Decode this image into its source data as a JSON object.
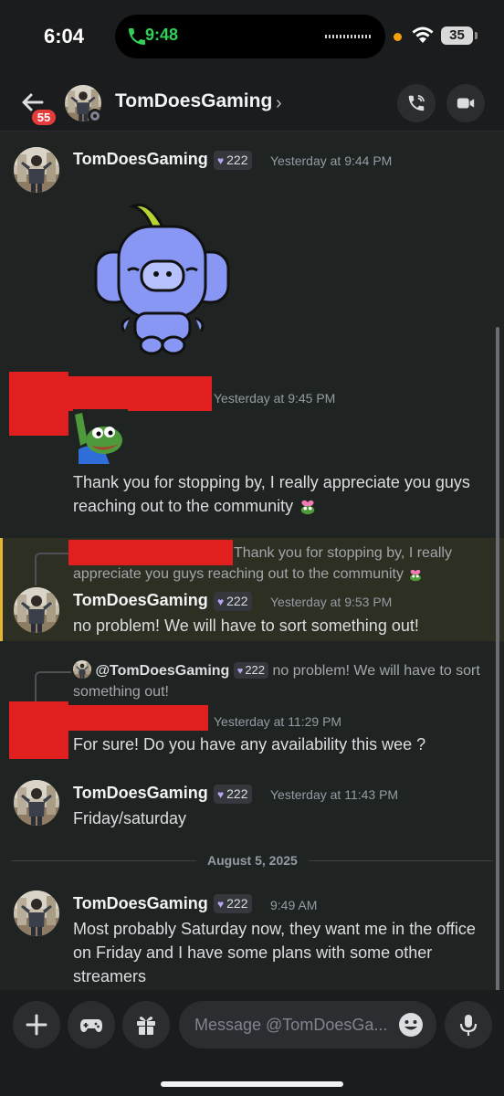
{
  "status_bar": {
    "time": "6:04",
    "call_time": "9:48",
    "battery": "35"
  },
  "header": {
    "back_badge": "55",
    "title": "TomDoesGaming",
    "chevron": "›",
    "icons": [
      "back-arrow-icon",
      "phone-call-icon",
      "video-camera-icon"
    ]
  },
  "messages": [
    {
      "author": "TomDoesGaming",
      "tag": "222",
      "timestamp": "Yesterday at 9:44 PM",
      "sticker": "wumpus-sticker"
    },
    {
      "author": "",
      "timestamp": "Yesterday at 9:45 PM",
      "image": "pepe-wave-emoji",
      "text": "Thank you for stopping by, I really appreciate you guys reaching out to the community"
    },
    {
      "reply_preview": "Thank you for stopping by, I really appreciate you guys reaching out to the community",
      "author": "TomDoesGaming",
      "tag": "222",
      "timestamp": "Yesterday at 9:53 PM",
      "text": "no problem! We will have to sort something out!"
    },
    {
      "reply_author": "@TomDoesGaming",
      "reply_tag": "222",
      "reply_preview": "no problem! We will have to sort something out!",
      "timestamp": "Yesterday at 11:29 PM",
      "text": "For sure! Do you have any availability this wee ?"
    },
    {
      "author": "TomDoesGaming",
      "tag": "222",
      "timestamp": "Yesterday at 11:43 PM",
      "text": "Friday/saturday"
    },
    {
      "author": "TomDoesGaming",
      "tag": "222",
      "timestamp": "9:49 AM",
      "text": "Most probably Saturday now, they want me in the office on Friday and I have some plans with some other streamers"
    }
  ],
  "date_divider": "August 5, 2025",
  "composer": {
    "placeholder": "Message @TomDoesGa..."
  },
  "colors": {
    "background": "#1f2422",
    "highlight": "#2d2f23",
    "highlight_bar": "#e7b535",
    "redaction": "#e21f1f",
    "badge": "#e53b3b"
  }
}
